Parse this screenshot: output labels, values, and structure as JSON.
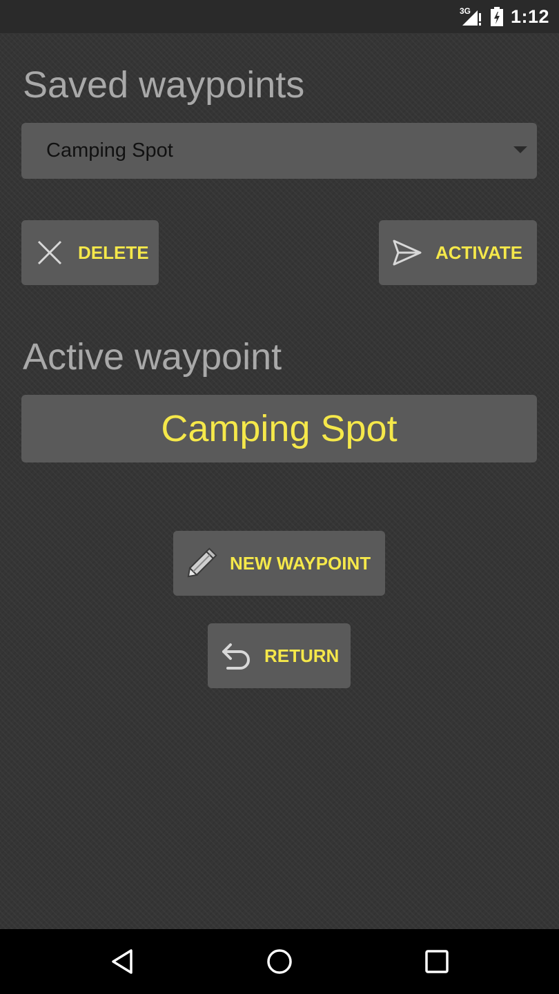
{
  "status_bar": {
    "network": "3G",
    "time": "1:12"
  },
  "saved_section": {
    "heading": "Saved waypoints",
    "selected_waypoint": "Camping Spot",
    "delete_label": "DELETE",
    "activate_label": "ACTIVATE"
  },
  "active_section": {
    "heading": "Active waypoint",
    "value": "Camping Spot"
  },
  "actions": {
    "new_waypoint_label": "NEW WAYPOINT",
    "return_label": "RETURN"
  },
  "icons": {
    "delete": "close-icon",
    "activate": "send-icon",
    "new_waypoint": "pencil-icon",
    "return": "undo-icon",
    "nav_back": "back-triangle-icon",
    "nav_home": "home-circle-icon",
    "nav_recents": "recents-square-icon"
  },
  "colors": {
    "background": "#353535",
    "panel": "#5a5a5a",
    "accent": "#f5e84a",
    "heading": "#a9a9a9"
  }
}
